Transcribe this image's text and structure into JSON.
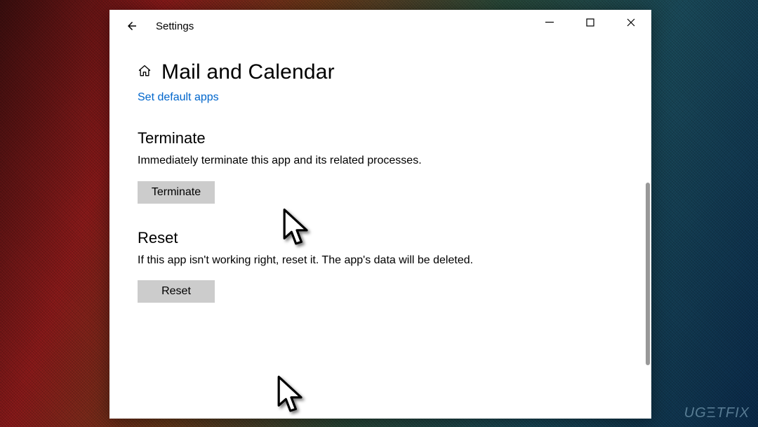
{
  "titlebar": {
    "title": "Settings"
  },
  "page": {
    "title": "Mail and Calendar",
    "link": "Set default apps"
  },
  "sections": {
    "terminate": {
      "title": "Terminate",
      "desc": "Immediately terminate this app and its related processes.",
      "button": "Terminate"
    },
    "reset": {
      "title": "Reset",
      "desc": "If this app isn't working right, reset it. The app's data will be deleted.",
      "button": "Reset"
    }
  },
  "watermark": "UG   TFIX"
}
